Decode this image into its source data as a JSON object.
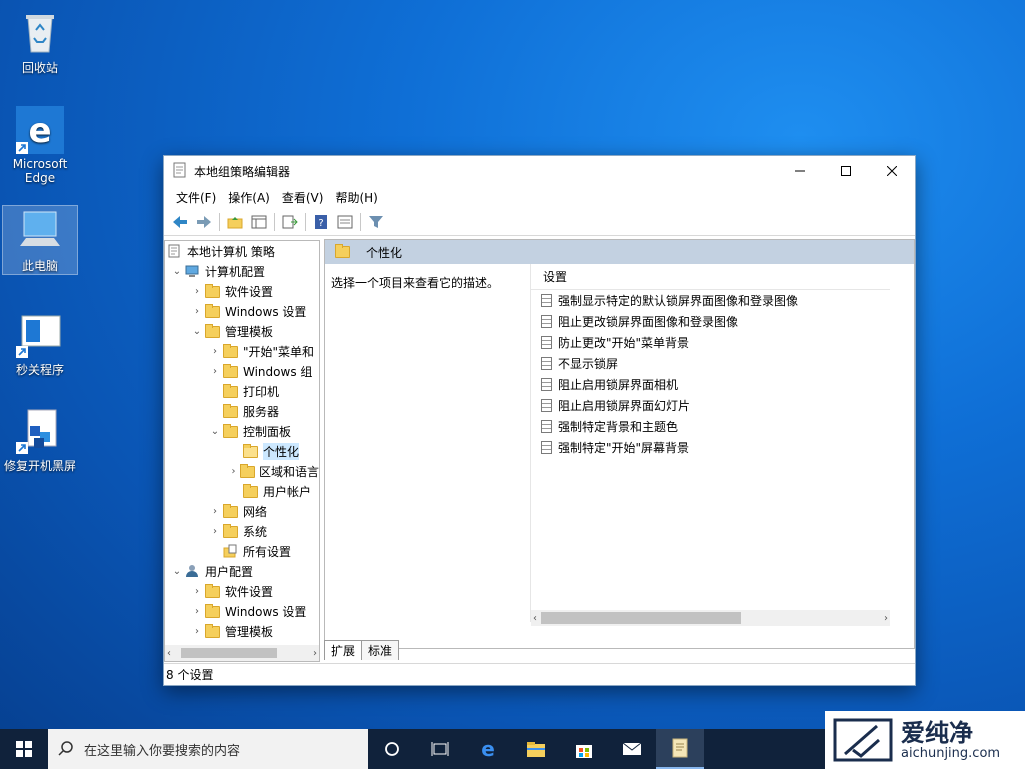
{
  "desktop": {
    "icons": [
      {
        "label": "回收站"
      },
      {
        "label": "Microsoft Edge"
      },
      {
        "label": "此电脑"
      },
      {
        "label": "秒关程序"
      },
      {
        "label": "修复开机黑屏"
      }
    ]
  },
  "window": {
    "title": "本地组策略编辑器",
    "menu": [
      "文件(F)",
      "操作(A)",
      "查看(V)",
      "帮助(H)"
    ],
    "tree": [
      {
        "label": "本地计算机 策略"
      },
      {
        "label": "计算机配置"
      },
      {
        "label": "软件设置"
      },
      {
        "label": "Windows 设置"
      },
      {
        "label": "管理模板"
      },
      {
        "label": "\"开始\"菜单和"
      },
      {
        "label": "Windows 组"
      },
      {
        "label": "打印机"
      },
      {
        "label": "服务器"
      },
      {
        "label": "控制面板"
      },
      {
        "label": "个性化"
      },
      {
        "label": "区域和语言"
      },
      {
        "label": "用户帐户"
      },
      {
        "label": "网络"
      },
      {
        "label": "系统"
      },
      {
        "label": "所有设置"
      },
      {
        "label": "用户配置"
      },
      {
        "label": "软件设置"
      },
      {
        "label": "Windows 设置"
      },
      {
        "label": "管理模板"
      }
    ],
    "right_header": "个性化",
    "description": "选择一个项目来查看它的描述。",
    "list_header": "设置",
    "settings": [
      "强制显示特定的默认锁屏界面图像和登录图像",
      "阻止更改锁屏界面图像和登录图像",
      "防止更改\"开始\"菜单背景",
      "不显示锁屏",
      "阻止启用锁屏界面相机",
      "阻止启用锁屏界面幻灯片",
      "强制特定背景和主题色",
      "强制特定\"开始\"屏幕背景"
    ],
    "tabs": [
      "扩展",
      "标准"
    ],
    "status": "8 个设置"
  },
  "taskbar": {
    "search_placeholder": "在这里输入你要搜索的内容"
  },
  "watermark": {
    "cn": "爱纯净",
    "url": "aichunjing.com"
  }
}
